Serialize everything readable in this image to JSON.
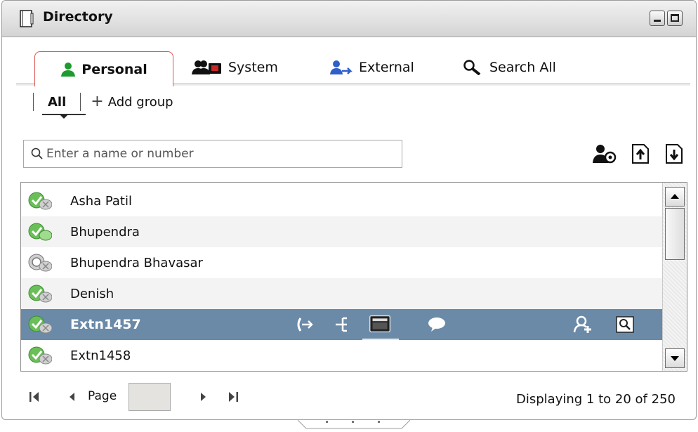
{
  "window": {
    "title": "Directory"
  },
  "tabs": [
    {
      "label": "Personal",
      "icon": "person-icon",
      "active": true
    },
    {
      "label": "System",
      "icon": "system-contacts-icon",
      "active": false
    },
    {
      "label": "External",
      "icon": "external-contacts-icon",
      "active": false
    },
    {
      "label": "Search All",
      "icon": "magnifier-icon",
      "active": false
    }
  ],
  "subnav": {
    "all_label": "All",
    "add_group_label": "Add group"
  },
  "search": {
    "placeholder": "Enter a name or number"
  },
  "contacts": [
    {
      "name": "Asha Patil",
      "status": "available-offline"
    },
    {
      "name": "Bhupendra",
      "status": "available-online"
    },
    {
      "name": "Bhupendra Bhavasar",
      "status": "offline"
    },
    {
      "name": "Denish",
      "status": "available-offline"
    },
    {
      "name": "Extn1457",
      "status": "available-offline",
      "selected": true
    },
    {
      "name": "Extn1458",
      "status": "available-offline"
    }
  ],
  "pager": {
    "page_label": "Page",
    "page_value": "",
    "display_text": "Displaying 1 to 20 of 250"
  },
  "colors": {
    "selected_row": "#6a8aa8",
    "active_tab_border": "#d9534f",
    "personal_icon": "#1e9a2e",
    "external_icon": "#2f5fc8"
  }
}
